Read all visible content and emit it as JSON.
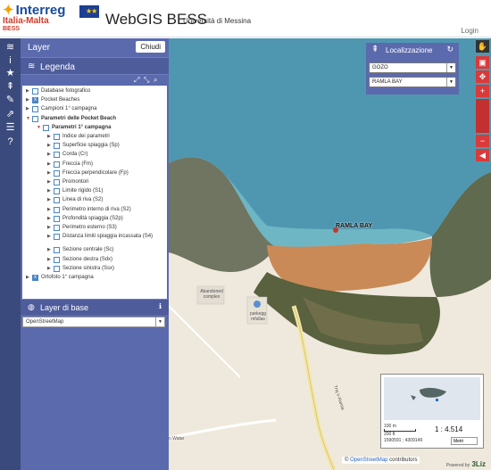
{
  "header": {
    "logo_main": "Interreg",
    "logo_sub": "Italia-Malta",
    "logo_project": "BESS",
    "app_title": "WebGIS BESS",
    "app_subtitle": "Università di Messina",
    "login_label": "Login"
  },
  "toolbar_icons": [
    "layers-icon",
    "info-icon",
    "star-icon",
    "locate-icon",
    "edit-icon",
    "share-icon",
    "list-icon",
    "help-icon"
  ],
  "panel": {
    "title": "Layer",
    "close_label": "Chiudi",
    "legend_title": "Legenda",
    "tree": [
      {
        "label": "Database fotografico",
        "checked": false,
        "depth": 0,
        "expanded": false
      },
      {
        "label": "Pocket Beaches",
        "checked": true,
        "depth": 0,
        "expanded": false
      },
      {
        "label": "Campioni 1° campagna",
        "checked": false,
        "depth": 0,
        "expanded": false
      },
      {
        "label": "Parametri delle Pocket Beach",
        "checked": false,
        "depth": 0,
        "expanded": true,
        "bold": true
      },
      {
        "label": "Parametri 1° campagna",
        "checked": false,
        "depth": 1,
        "expanded": true,
        "bold": true
      },
      {
        "label": "Indice dei parametri",
        "checked": false,
        "depth": 2,
        "expanded": false
      },
      {
        "label": "Superficie spiaggia (Sp)",
        "checked": false,
        "depth": 2,
        "expanded": false
      },
      {
        "label": "Corda (Cr)",
        "checked": false,
        "depth": 2,
        "expanded": false
      },
      {
        "label": "Freccia (Fm)",
        "checked": false,
        "depth": 2,
        "expanded": false
      },
      {
        "label": "Freccia perpendicolare (Fp)",
        "checked": false,
        "depth": 2,
        "expanded": false
      },
      {
        "label": "Promontori",
        "checked": false,
        "depth": 2,
        "expanded": false
      },
      {
        "label": "Limite rigido (S1)",
        "checked": false,
        "depth": 2,
        "expanded": false
      },
      {
        "label": "Linea di riva (S2)",
        "checked": false,
        "depth": 2,
        "expanded": false
      },
      {
        "label": "Perimetro interno di riva (S2)",
        "checked": false,
        "depth": 2,
        "expanded": false
      },
      {
        "label": "Profondità spiaggia (S2p)",
        "checked": false,
        "depth": 2,
        "expanded": false
      },
      {
        "label": "Perimetro esterno (S3)",
        "checked": false,
        "depth": 2,
        "expanded": false
      },
      {
        "label": "Distanza limiti spiaggia incassata (S4)",
        "checked": false,
        "depth": 2,
        "expanded": false
      },
      {
        "label": "Sezione centrale (Sc)",
        "checked": false,
        "depth": 2,
        "expanded": false
      },
      {
        "label": "Sezione destra (Sdx)",
        "checked": false,
        "depth": 2,
        "expanded": false
      },
      {
        "label": "Sezione sinistra (Ssx)",
        "checked": false,
        "depth": 2,
        "expanded": false
      },
      {
        "label": "Ortofoto 1° campagna",
        "checked": true,
        "depth": 0,
        "expanded": false
      }
    ],
    "base_title": "Layer di base",
    "base_selected": "OpenStreetMap"
  },
  "localization": {
    "title": "Localizzazione",
    "island": "GOZO",
    "beach": "RAMLA BAY"
  },
  "map": {
    "place_label": "RAMLA BAY",
    "poi_1": "Abandoned complex",
    "poi_2": "parkegg\nmfullas",
    "road_label": "Triq ir-Ramla",
    "road_label_2": "n Watar",
    "attribution_prefix": "©",
    "attribution_link": "OpenStreetMap",
    "attribution_suffix": "contributors",
    "powered_by": "Powered by",
    "brand": "3Liz"
  },
  "overview": {
    "scale_label": "100 m",
    "scale_label_2": "200 ft",
    "zoom": "1 : 4.514",
    "coords": "1590591 ; 4309149",
    "units": "Metri"
  },
  "colors": {
    "panel": "#5b6aad",
    "toolbar": "#3b4a7d",
    "accent_red": "#d93a3a",
    "checkbox": "#4a86c5"
  }
}
